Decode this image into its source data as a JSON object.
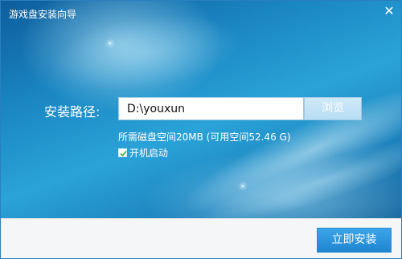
{
  "window": {
    "title": "游戏盘安装向导",
    "close_glyph": "✕"
  },
  "install": {
    "path_label": "安装路径:",
    "path_value": "D:\\youxun",
    "browse_label": "浏览",
    "space_info": "所需磁盘空间20MB (可用空间52.46 G)",
    "autostart_label": "开机启动",
    "autostart_checked": true
  },
  "footer": {
    "install_button_label": "立即安装"
  },
  "colors": {
    "accent": "#1f86cf",
    "title_bar_text": "#ffffff",
    "checkmark": "#3bb03b"
  }
}
